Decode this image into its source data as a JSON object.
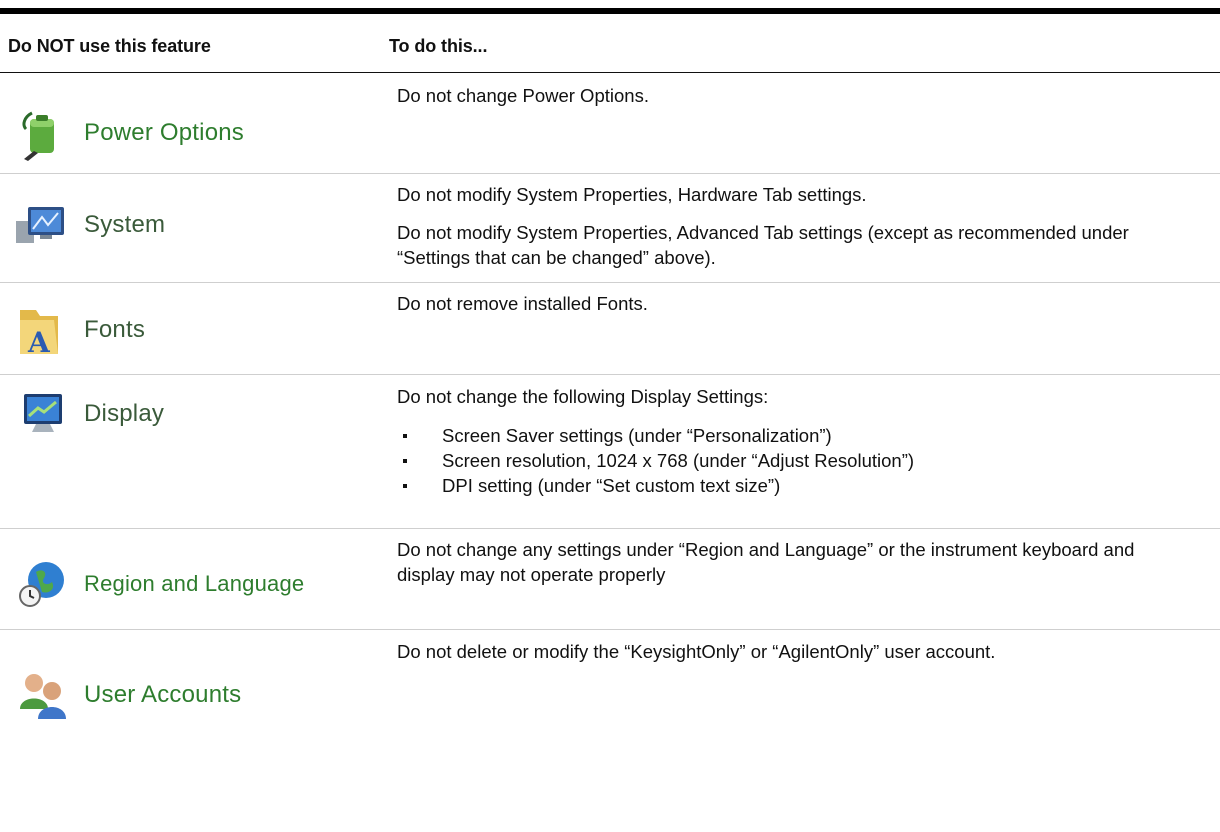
{
  "header": {
    "col1": "Do NOT use this feature",
    "col2": "To do this..."
  },
  "rows": [
    {
      "feature": "Power Options",
      "icon": "power-options-icon",
      "desc": [
        "Do not change Power Options."
      ]
    },
    {
      "feature": "System",
      "icon": "system-computer-icon",
      "desc": [
        "Do not modify System Properties, Hardware Tab settings.",
        "Do not modify System Properties, Advanced Tab settings (except as recommended under “Settings that can be changed” above)."
      ]
    },
    {
      "feature": "Fonts",
      "icon": "fonts-folder-icon",
      "desc": [
        "Do not remove installed Fonts."
      ]
    },
    {
      "feature": "Display",
      "icon": "display-monitor-icon",
      "desc": [
        "Do not change the following Display Settings:"
      ],
      "bullets": [
        "Screen Saver settings (under “Personalization”)",
        "Screen resolution, 1024 x 768 (under “Adjust Resolution”)",
        "DPI setting (under “Set custom text size”)"
      ]
    },
    {
      "feature": "Region and Language",
      "icon": "globe-clock-icon",
      "desc": [
        "Do not change any settings under “Region and Language” or the instrument keyboard and display may not operate properly"
      ]
    },
    {
      "feature": "User Accounts",
      "icon": "user-accounts-icon",
      "desc": [
        "Do not delete or modify the “KeysightOnly” or “AgilentOnly” user account."
      ]
    }
  ]
}
